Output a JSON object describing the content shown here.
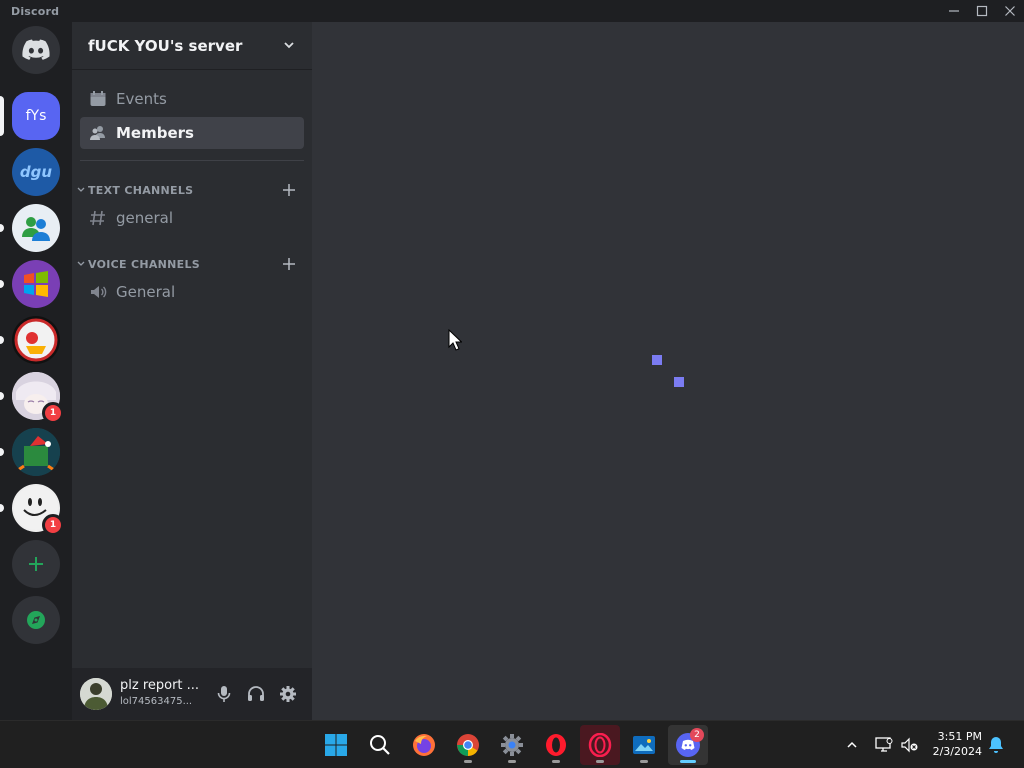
{
  "window": {
    "app_name": "Discord",
    "icons": {
      "minimize": "minimize-icon",
      "maximize": "maximize-icon",
      "close": "close-icon"
    }
  },
  "server_rail": {
    "home_icon": "discord-logo-icon",
    "servers": [
      {
        "initials": "fYs",
        "color": "#5865f2",
        "selected": true,
        "unread": false,
        "badge": ""
      },
      {
        "initials": "dgu",
        "color": "#1e5aa6",
        "selected": false,
        "unread": false,
        "badge": ""
      },
      {
        "initials": "",
        "color": "#e8eef4",
        "selected": false,
        "unread": true,
        "badge": ""
      },
      {
        "initials": "",
        "color": "#7a3fb5",
        "selected": false,
        "unread": true,
        "badge": ""
      },
      {
        "initials": "",
        "color": "#111111",
        "selected": false,
        "unread": true,
        "badge": ""
      },
      {
        "initials": "",
        "color": "#e4dde6",
        "selected": false,
        "unread": true,
        "badge": "1"
      },
      {
        "initials": "",
        "color": "#1b4d5c",
        "selected": false,
        "unread": true,
        "badge": ""
      },
      {
        "initials": "",
        "color": "#eeeeee",
        "selected": false,
        "unread": true,
        "badge": "1"
      }
    ],
    "add_server_icon": "plus-icon",
    "explore_icon": "compass-icon"
  },
  "sidebar": {
    "server_name": "fUCK YOU's server",
    "nav": [
      {
        "label": "Events",
        "icon": "calendar-icon",
        "active": false
      },
      {
        "label": "Members",
        "icon": "members-icon",
        "active": true
      }
    ],
    "categories": [
      {
        "label": "TEXT CHANNELS",
        "channels": [
          {
            "name": "general",
            "icon": "hash-icon"
          }
        ]
      },
      {
        "label": "VOICE CHANNELS",
        "channels": [
          {
            "name": "General",
            "icon": "speaker-icon"
          }
        ]
      }
    ]
  },
  "user_panel": {
    "display_name": "plz report ...",
    "username": "lol74563475...",
    "icons": {
      "mic": "microphone-icon",
      "headset": "headset-icon",
      "settings": "gear-icon"
    }
  },
  "taskbar": {
    "apps": [
      {
        "name": "start-icon"
      },
      {
        "name": "search-icon"
      },
      {
        "name": "firefox-icon"
      },
      {
        "name": "chrome-icon"
      },
      {
        "name": "settings-app-icon"
      },
      {
        "name": "opera-icon"
      },
      {
        "name": "opera-gx-icon"
      },
      {
        "name": "photos-icon"
      },
      {
        "name": "discord-icon",
        "badge": "2"
      }
    ],
    "time": "3:51 PM",
    "date": "2/3/2024"
  },
  "colors": {
    "blurple": "#5865f2",
    "rail_bg": "#1e1f22",
    "sidebar_bg": "#2b2d31",
    "main_bg": "#313338",
    "green_accent": "#23a55a"
  }
}
